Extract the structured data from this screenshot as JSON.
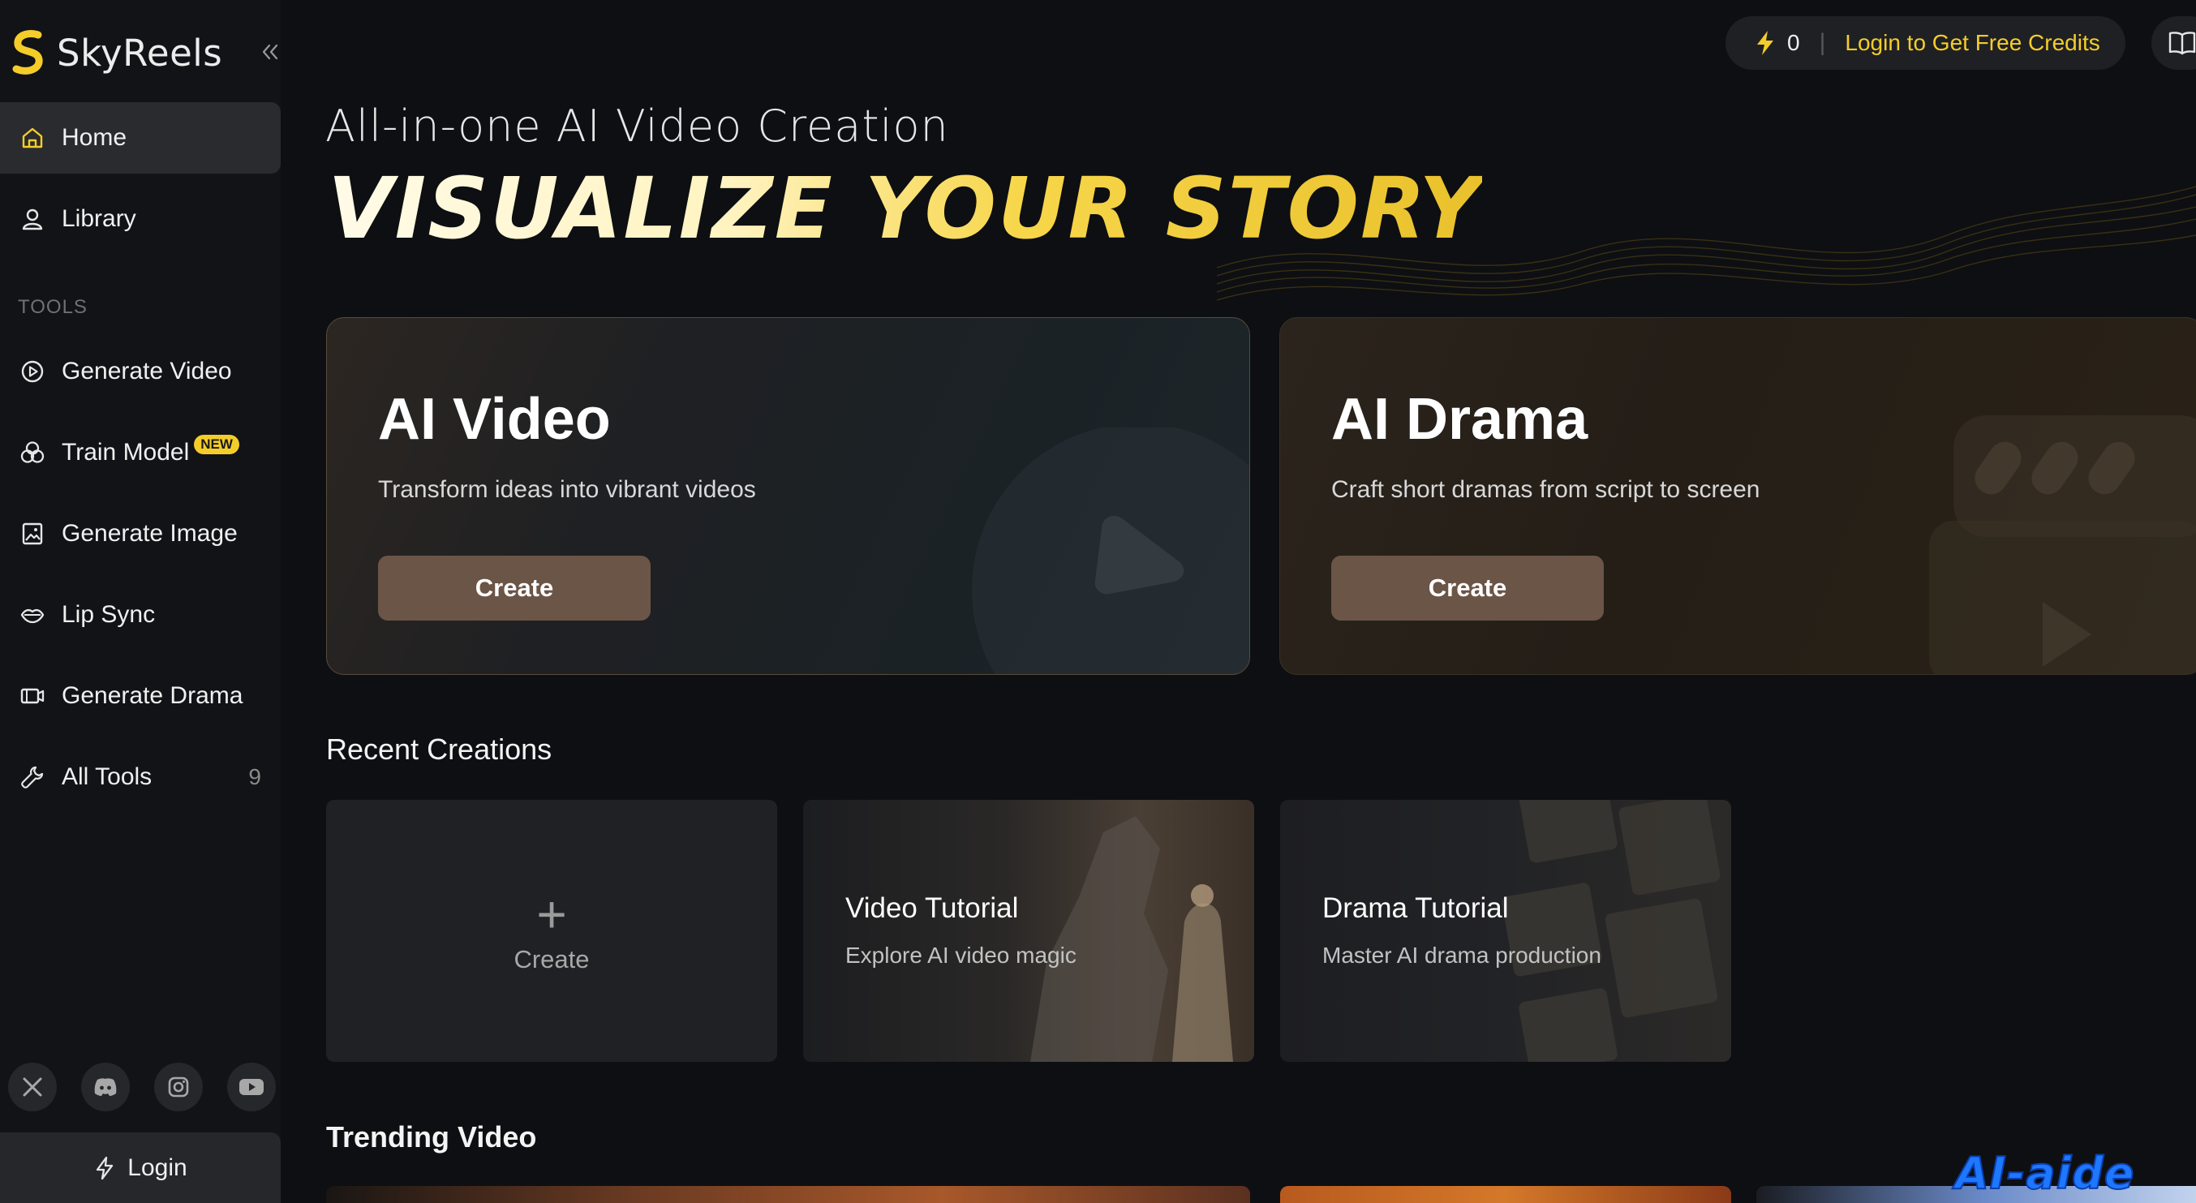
{
  "brand": {
    "name": "SkyReels",
    "accent": "#f4cd2a"
  },
  "sidebar": {
    "collapse_icon": "double-chevron-left-icon",
    "main_items": [
      {
        "label": "Home",
        "icon": "home-icon",
        "active": true
      },
      {
        "label": "Library",
        "icon": "user-icon"
      }
    ],
    "tools_label": "TOOLS",
    "tools": [
      {
        "label": "Generate Video",
        "icon": "play-circle-icon"
      },
      {
        "label": "Train Model",
        "icon": "circles-icon",
        "badge": "NEW"
      },
      {
        "label": "Generate Image",
        "icon": "image-icon"
      },
      {
        "label": "Lip Sync",
        "icon": "lips-icon"
      },
      {
        "label": "Generate Drama",
        "icon": "film-icon"
      },
      {
        "label": "All Tools",
        "icon": "wrench-icon",
        "count": "9"
      }
    ],
    "socials": [
      "x-icon",
      "discord-icon",
      "instagram-icon",
      "youtube-icon"
    ],
    "login_label": "Login"
  },
  "topbar": {
    "credits": "0",
    "credits_cta": "Login to Get Free Credits"
  },
  "hero": {
    "subtitle": "All-in-one AI Video Creation",
    "title": "VISUALIZE YOUR STORY"
  },
  "features": [
    {
      "title": "AI Video",
      "desc": "Transform ideas into vibrant videos",
      "button": "Create"
    },
    {
      "title": "AI Drama",
      "desc": "Craft short dramas from script to screen",
      "button": "Create"
    }
  ],
  "recent": {
    "title": "Recent Creations",
    "create_label": "Create",
    "tutorials": [
      {
        "title": "Video Tutorial",
        "subtitle": "Explore AI video magic"
      },
      {
        "title": "Drama Tutorial",
        "subtitle": "Master AI drama production"
      }
    ]
  },
  "trending": {
    "title": "Trending Video"
  },
  "watermark": "AI-aide"
}
